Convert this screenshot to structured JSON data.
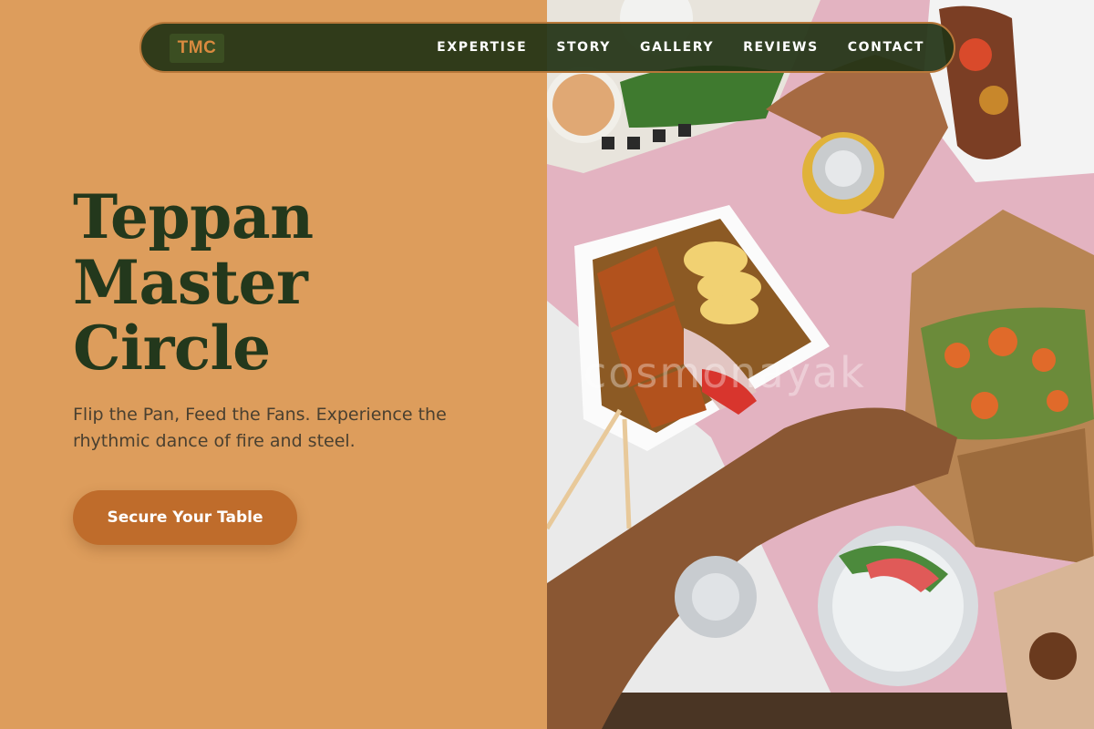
{
  "nav": {
    "logo": "TMC",
    "links": [
      "EXPERTISE",
      "STORY",
      "GALLERY",
      "REVIEWS",
      "CONTACT"
    ]
  },
  "hero": {
    "title_lines": [
      "Teppan",
      "Master",
      "Circle"
    ],
    "subtitle": "Flip the Pan, Feed the Fans. Experience the rhythmic dance of fire and steel.",
    "cta": "Secure Your Table"
  },
  "photo": {
    "watermark": "cosmonayak"
  },
  "colors": {
    "background": "#dd9d5c",
    "nav_bg": "#223416",
    "nav_border": "#b8783a",
    "title": "#23381c",
    "cta_bg": "#bf6c2b",
    "logo_text": "#d98a3f"
  }
}
